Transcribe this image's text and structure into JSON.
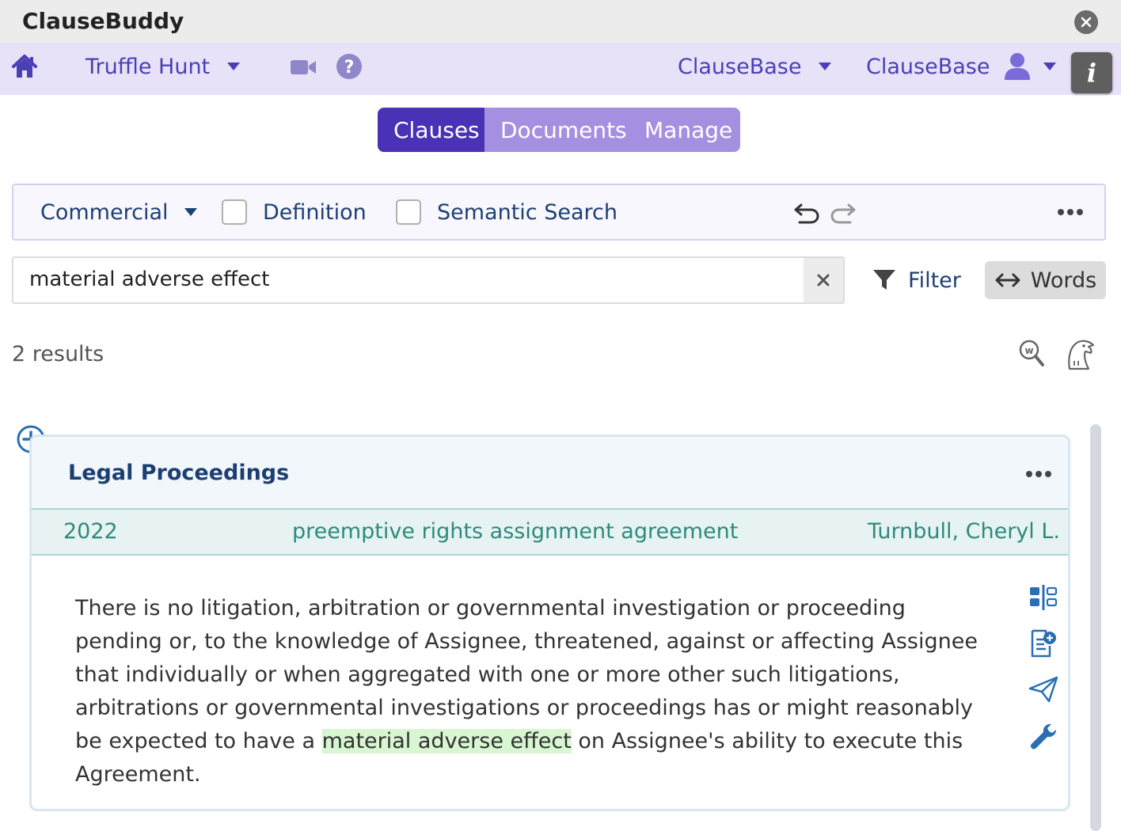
{
  "window": {
    "title": "ClauseBuddy"
  },
  "nav": {
    "workspace": "Truffle Hunt",
    "library": "ClauseBase",
    "user": "ClauseBase",
    "info": "i"
  },
  "tabs": [
    {
      "label": "Clauses",
      "active": true
    },
    {
      "label": "Documents",
      "active": false
    },
    {
      "label": "Manage",
      "active": false
    }
  ],
  "toolbar": {
    "category": "Commercial",
    "definition_label": "Definition",
    "definition_checked": false,
    "semantic_label": "Semantic Search",
    "semantic_checked": false
  },
  "search": {
    "value": "material adverse effect",
    "filter_label": "Filter",
    "words_label": "Words"
  },
  "results": {
    "count_text": "2 results"
  },
  "clause": {
    "title": "Legal Proceedings",
    "year": "2022",
    "document": "preemptive rights assignment agreement",
    "author": "Turnbull, Cheryl L.",
    "text_before": "There is no litigation, arbitration or governmental investigation or proceeding pending or, to the knowledge of Assignee, threatened, against or affecting Assignee that individually or when aggregated with one or more other such litigations, arbitrations or governmental investigations or proceedings has or might reasonably be expected to have a ",
    "text_highlight": "material adverse effect",
    "text_after": " on Assignee's ability to execute this Agreement."
  },
  "colors": {
    "accent": "#4a31b5",
    "nav_bg": "#e7e2f7",
    "tab_inactive": "#a48fe0",
    "highlight": "#d8f6d2",
    "meta_text": "#2f8a7c"
  }
}
